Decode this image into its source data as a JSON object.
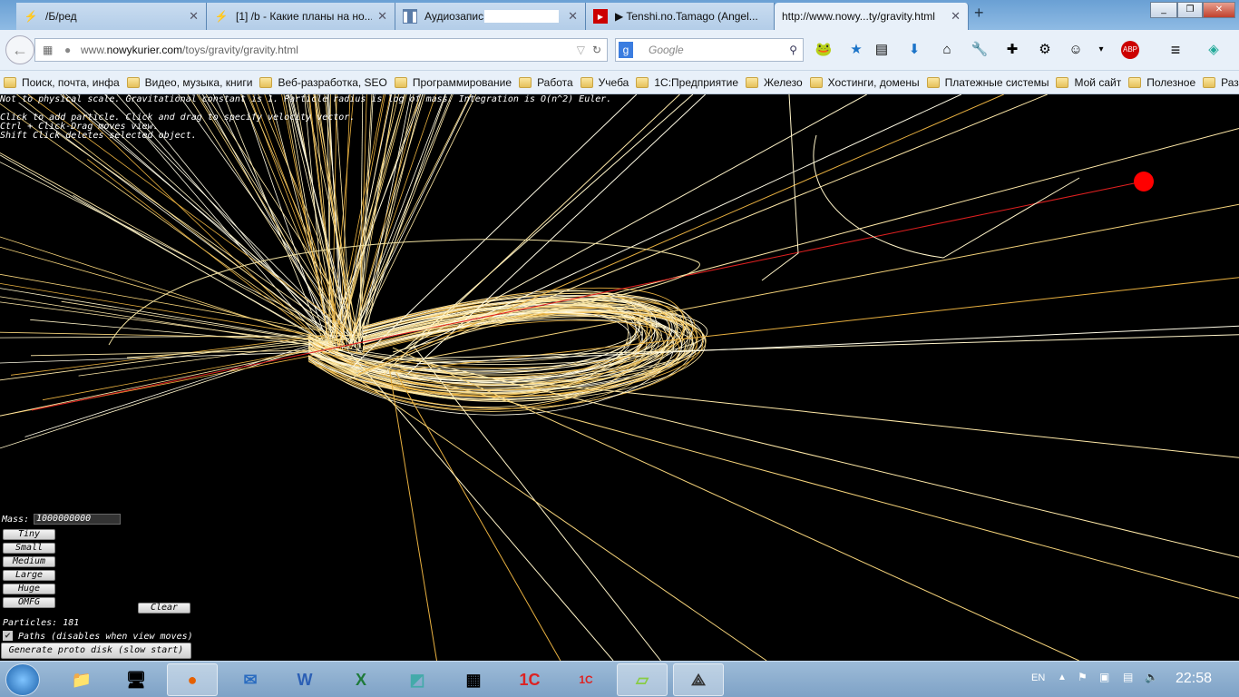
{
  "tabs": [
    {
      "label": "/Б/ред",
      "icon": "lightning-icon"
    },
    {
      "label": "[1] /b - Какие планы на но...",
      "icon": "lightning-icon"
    },
    {
      "label": "Аудиозаписи",
      "icon": "pause-icon"
    },
    {
      "label": "▶ Tenshi.no.Tamago (Angel...",
      "icon": "youtube-icon"
    },
    {
      "label": "http://www.nowy...ty/gravity.html",
      "icon": ""
    }
  ],
  "new_tab": "+",
  "url": {
    "prefix": "www.",
    "domain": "nowykurier.com",
    "path": "/toys/gravity/gravity.html"
  },
  "search_placeholder": "Google",
  "bookmarks": [
    "Поиск, почта, инфа",
    "Видео, музыка, книги",
    "Веб-разработка, SEO",
    "Программирование",
    "Работа",
    "Учеба",
    "1С:Предприятие",
    "Железо",
    "Хостинги, домены",
    "Платежные системы",
    "Мой сайт",
    "Полезное",
    "Разное"
  ],
  "info": {
    "line1": "Not to physical scale. Gravitational constant is 1. Particle radius is log of mass. Integration is O(n^2) Euler.",
    "line2": "Click to add particle. Click and drag to specify velocity vector.",
    "line3": "Ctrl + Click-Drag moves view.",
    "line4": "Shift Click deletes selected object."
  },
  "controls": {
    "mass_label": "Mass:",
    "mass_value": "1000000000",
    "sizes": [
      "Tiny",
      "Small",
      "Medium",
      "Large",
      "Huge",
      "OMFG"
    ],
    "clear": "Clear",
    "particles": "Particles: 181",
    "paths_label": "Paths (disables when view moves)",
    "paths_checked": true,
    "proto_disk": "Generate proto disk (slow start)"
  },
  "tray": {
    "lang": "EN",
    "time": "22:58"
  }
}
